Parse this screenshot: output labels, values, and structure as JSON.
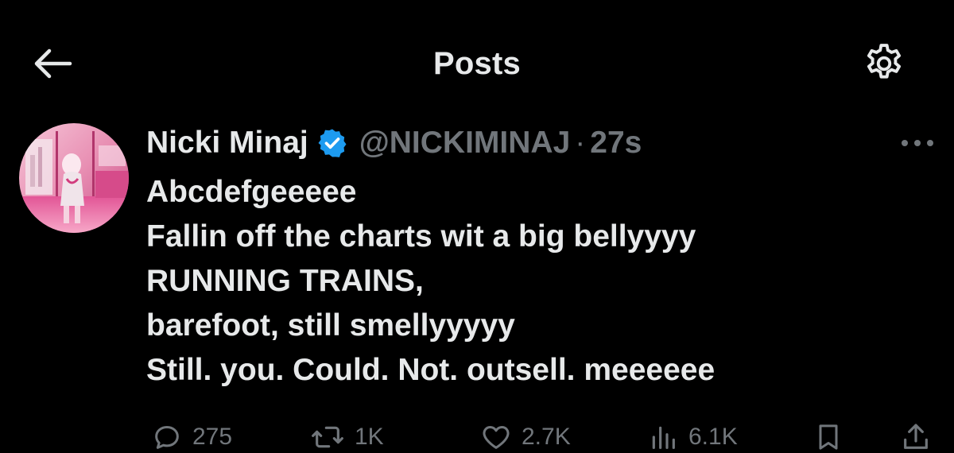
{
  "header": {
    "title": "Posts",
    "back_icon": "arrow-left-icon",
    "settings_icon": "gear-icon"
  },
  "tweet": {
    "display_name": "Nicki Minaj",
    "verified_icon": "verified-badge-icon",
    "handle": "@NICKIMINAJ",
    "separator": "·",
    "time": "27s",
    "more_icon": "more-dots-icon",
    "lines": [
      "Abcdefgeeeee",
      "Fallin off the charts wit a big bellyyyy",
      "RUNNING TRAINS,",
      "barefoot, still smellyyyyy",
      "Still. you. Could. Not. outsell. meeeeee"
    ]
  },
  "actions": {
    "replies": "275",
    "reposts": "1K",
    "likes": "2.7K",
    "views": "6.1K",
    "bookmark_icon": "bookmark-icon",
    "share_icon": "share-icon"
  },
  "colors": {
    "background": "#000000",
    "primary_text": "#e7e9ea",
    "secondary_text": "#71767b",
    "verified_blue": "#1d9bf0"
  }
}
